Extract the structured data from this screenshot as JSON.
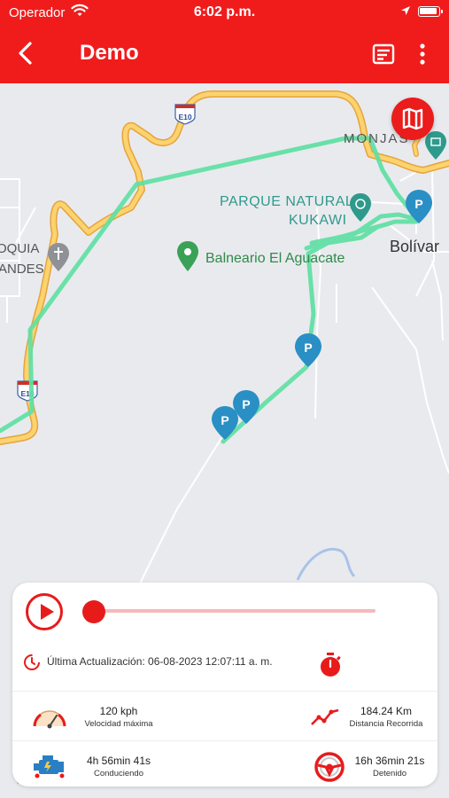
{
  "status_bar": {
    "carrier": "Operador",
    "time": "6:02 p.m."
  },
  "header": {
    "title": "Demo"
  },
  "map": {
    "labels": {
      "monjas": "MONJAS",
      "parque_line1": "PARQUE NATURAL",
      "parque_line2": "KUKAWI",
      "bolivar": "Bolívar",
      "balneario": "Balneario El Aguacate",
      "oquia": "OQUIA",
      "andes": "ANDES"
    },
    "road_shields": [
      "E10",
      "E10"
    ],
    "parking_markers": 4,
    "route_color": "#5fe0a4"
  },
  "panel": {
    "playback_progress": 0,
    "last_update": "Última Actualización: 06-08-2023 12:07:11 a. m.",
    "stats": {
      "max_speed_value": "120 kph",
      "max_speed_label": "Velocidad máxima",
      "distance_value": "184.24 Km",
      "distance_label": "Distancia Recorrida",
      "driving_value": "4h 56min 41s",
      "driving_label": "Conduciendo",
      "stopped_value": "16h 36min 21s",
      "stopped_label": "Detenido"
    }
  },
  "colors": {
    "brand_red": "#f01c1c",
    "accent_red": "#e81b1b",
    "route_green": "#5fe0a4",
    "parking_blue": "#2a8fc4"
  }
}
